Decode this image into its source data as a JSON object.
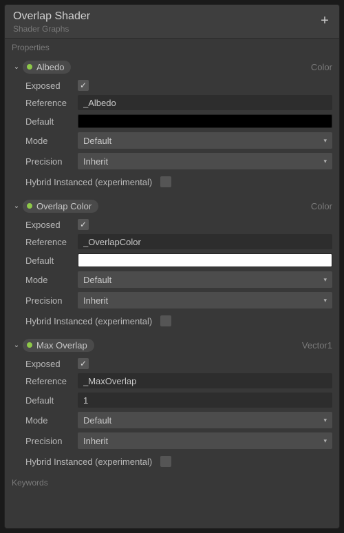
{
  "title": "Overlap Shader",
  "subtitle": "Shader Graphs",
  "plus": "+",
  "properties_label": "Properties",
  "keywords_label": "Keywords",
  "check_glyph": "✓",
  "dd_glyph": "▾",
  "arrow_glyph": "⌄",
  "labels": {
    "exposed": "Exposed",
    "reference": "Reference",
    "default": "Default",
    "mode": "Mode",
    "precision": "Precision",
    "hybrid": "Hybrid Instanced (experimental)"
  },
  "props": [
    {
      "name": "Albedo",
      "type": "Color",
      "exposed": true,
      "reference": "_Albedo",
      "default_color": "#000000",
      "default_text": null,
      "mode": "Default",
      "precision": "Inherit",
      "hybrid": false
    },
    {
      "name": "Overlap Color",
      "type": "Color",
      "exposed": true,
      "reference": "_OverlapColor",
      "default_color": "#ffffff",
      "default_text": null,
      "mode": "Default",
      "precision": "Inherit",
      "hybrid": false
    },
    {
      "name": "Max Overlap",
      "type": "Vector1",
      "exposed": true,
      "reference": "_MaxOverlap",
      "default_color": null,
      "default_text": "1",
      "mode": "Default",
      "precision": "Inherit",
      "hybrid": false
    }
  ]
}
